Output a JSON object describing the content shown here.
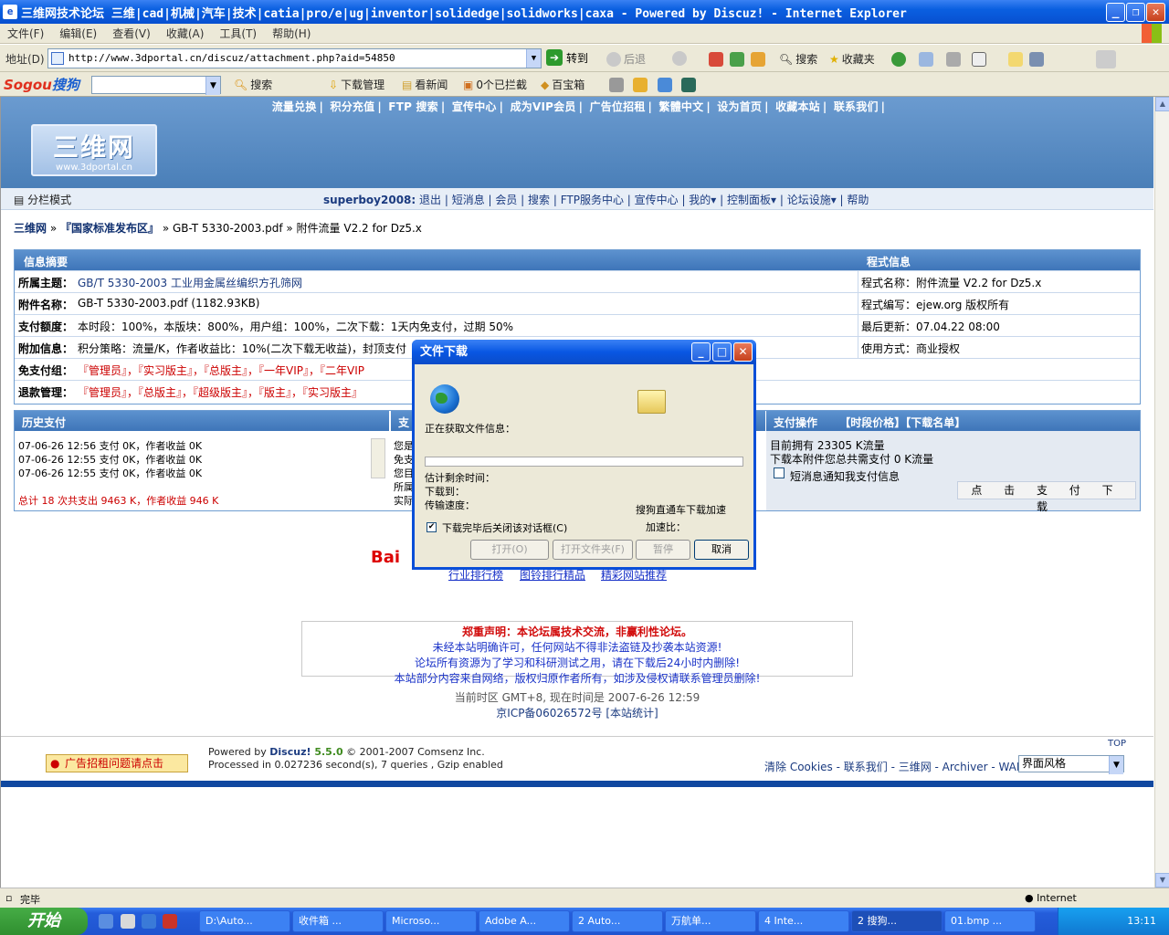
{
  "window": {
    "title": "三维网技术论坛 三维|cad|机械|汽车|技术|catia|pro/e|ug|inventor|solidedge|solidworks|caxa - Powered by Discuz! - Internet Explorer"
  },
  "menu": [
    "文件(F)",
    "编辑(E)",
    "查看(V)",
    "收藏(A)",
    "工具(T)",
    "帮助(H)"
  ],
  "address": {
    "label": "地址(D)",
    "url": "http://www.3dportal.cn/discuz/attachment.php?aid=54850",
    "go": "转到"
  },
  "toolbar": {
    "back": "后退",
    "search": "搜索",
    "favorites": "收藏夹"
  },
  "sogou": {
    "logo_a": "Sogou",
    "logo_b": "搜狗",
    "search": "搜索",
    "download": "下载管理",
    "news": "看新闻",
    "blocked": "0个已拦截",
    "treasure": "百宝箱"
  },
  "site": {
    "topnav": [
      "流量兑换",
      "积分充值",
      "FTP 搜索",
      "宣传中心",
      "成为VIP会员",
      "广告位招租",
      "繁體中文",
      "设为首页",
      "收藏本站",
      "联系我们"
    ],
    "logo_main": "三维网",
    "logo_sub": "www.3dportal.cn",
    "mode": "分栏模式",
    "user": "superboy2008:",
    "userlinks": "退出 | 短消息 | 会员 | 搜索 | FTP服务中心 | 宣传中心 | 我的▾ | 控制面板▾ | 论坛设施▾ | 帮助",
    "crumb_site": "三维网",
    "crumb_forum": "『国家标准发布区』",
    "crumb_rest": "» GB-T 5330-2003.pdf » 附件流量 V2.2 for Dz5.x"
  },
  "info": {
    "head_left": "信息摘要",
    "head_right": "程式信息",
    "rows": [
      {
        "k": "所属主题：",
        "v": "GB/T 5330-2003 工业用金属丝编织方孔筛网",
        "r": "程式名称：附件流量 V2.2 for Dz5.x"
      },
      {
        "k": "附件名称：",
        "v": "GB-T 5330-2003.pdf (1182.93KB)",
        "r": "程式编写：ejew.org 版权所有"
      },
      {
        "k": "支付额度：",
        "v": "本时段：100%，本版块：800%，用户组：100%，二次下载：1天内免支付，过期 50%",
        "r": "最后更新：07.04.22 08:00"
      },
      {
        "k": "附加信息：",
        "v": "积分策略：流量/K，作者收益比：10%(二次下载无收益)，封顶支付",
        "r": "使用方式：商业授权"
      },
      {
        "k": "免支付组：",
        "v": "『管理员』，『实习版主』，『总版主』，『一年VIP』，『二年VIP",
        "r": ""
      },
      {
        "k": "退款管理：",
        "v": "『管理员』，『总版主』，『超级版主』，『版主』，『实习版主』",
        "r": ""
      }
    ]
  },
  "history": {
    "head": "历史支付",
    "head2": "支",
    "lines": [
      "07-06-26 12:56 支付 0K，作者收益 0K",
      "07-06-26 12:55 支付 0K，作者收益 0K",
      "07-06-26 12:55 支付 0K，作者收益 0K"
    ],
    "total": "总计 18 次共支出 9463 K，作者收益 946 K",
    "mid_lines": [
      "您是",
      "免支",
      "您目",
      "所属",
      "实际"
    ]
  },
  "pay": {
    "head": "支付操作",
    "head_links": "【时段价格】【下载名单】",
    "own": "目前拥有 23305 K流量",
    "need": "下载本附件您总共需支付 0 K流量",
    "notify": "短消息通知我支付信息",
    "button": "点 击 支 付 下 载"
  },
  "baidu": {
    "logo": "Bai",
    "links": [
      "行业排行榜",
      "图铃排行精品",
      "精彩网站推荐"
    ]
  },
  "declaration": {
    "title": "郑重声明：本论坛属技术交流，非赢利性论坛。",
    "lines": [
      "未经本站明确许可，任何网站不得非法盗链及抄袭本站资源!",
      "论坛所有资源为了学习和科研测试之用，请在下载后24小时内删除!",
      "本站部分内容来自网络，版权归原作者所有，如涉及侵权请联系管理员删除!"
    ]
  },
  "timezone": "当前时区 GMT+8, 现在时间是 2007-6-26 12:59",
  "icp": "京ICP备06026572号 [本站统计]",
  "footer": {
    "ad": "广告招租问题请点击",
    "powered_a": "Powered by ",
    "powered_b": "Discuz!",
    "powered_c": " 5.5.0",
    "powered_d": " © 2001-2007 Comsenz Inc.",
    "processed": "Processed in 0.027236 second(s), 7 queries , Gzip enabled",
    "links": "清除 Cookies - 联系我们 - 三维网 - Archiver - WAP",
    "style": "界面风格",
    "top": "TOP"
  },
  "dialog": {
    "title": "文件下载",
    "fetching": "正在获取文件信息：",
    "remaining": "估计剩余时间：",
    "to": "下载到：",
    "speed": "传输速度：",
    "sogou_accel": "搜狗直通车下载加速",
    "ratio": "加速比：",
    "close_when_done": "下载完毕后关闭该对话框(C)",
    "btn_open": "打开(O)",
    "btn_open_folder": "打开文件夹(F)",
    "btn_pause": "暂停",
    "btn_cancel": "取消"
  },
  "status": {
    "text": "完毕",
    "zone": "Internet"
  },
  "taskbar": {
    "start": "开始",
    "tasks": [
      "D:\\Auto...",
      "收件箱 ...",
      "Microso...",
      "Adobe A...",
      "2 Auto...",
      "万航单...",
      "4 Inte...",
      "2 搜狗...",
      "01.bmp ..."
    ],
    "clock": "13:11"
  }
}
